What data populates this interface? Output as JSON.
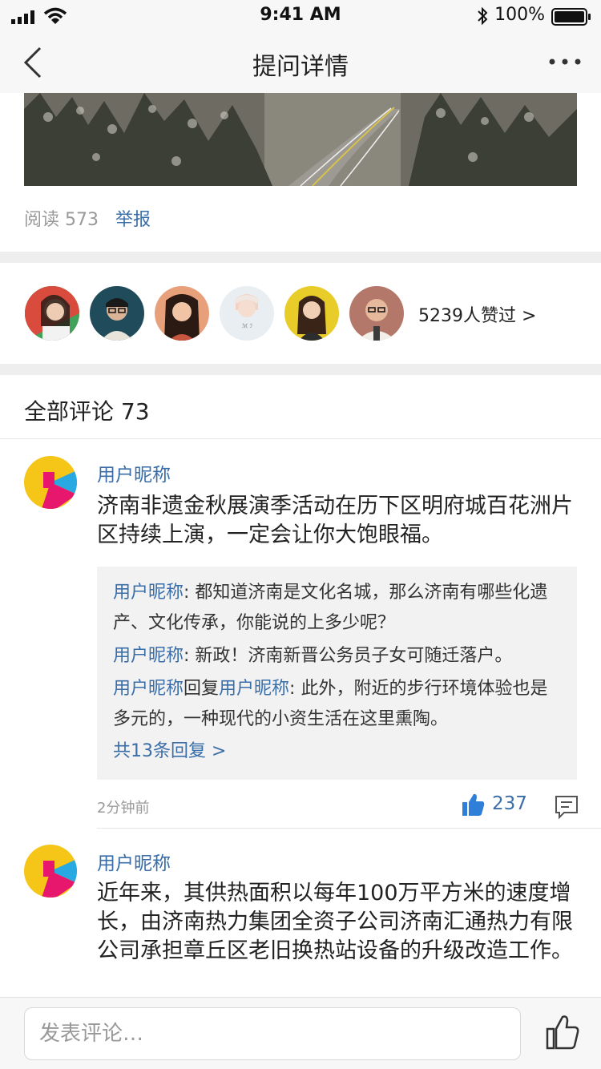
{
  "status_bar": {
    "time": "9:41 AM",
    "battery": "100%"
  },
  "nav": {
    "title": "提问详情"
  },
  "article": {
    "read_label": "阅读 573",
    "report_label": "举报"
  },
  "likers": {
    "avatars": [
      "avatar-1",
      "avatar-2",
      "avatar-3",
      "avatar-4",
      "avatar-5",
      "avatar-6"
    ],
    "count_label": "5239人赞过 >"
  },
  "comments_header": {
    "label": "全部评论 73"
  },
  "comments": [
    {
      "user": "用户昵称",
      "text": "济南非遗金秋展演季活动在历下区明府城百花洲片区持续上演，一定会让你大饱眼福。",
      "replies": [
        {
          "user": "用户昵称",
          "sep": ": ",
          "text": "都知道济南是文化名城，那么济南有哪些化遗产、文化传承，你能说的上多少呢？"
        },
        {
          "user": "用户昵称",
          "sep": ": ",
          "text": "新政！济南新晋公务员子女可随迁落户。"
        },
        {
          "user": "用户昵称",
          "mid": "回复",
          "to_user": "用户昵称",
          "sep": ": ",
          "text": "此外，附近的步行环境体验也是多元的，一种现代的小资生活在这里熏陶。"
        }
      ],
      "more_replies": "共13条回复 >",
      "time": "2分钟前",
      "likes": "237"
    },
    {
      "user": "用户昵称",
      "text": "近年来，其供热面积以每年100万平方米的速度增长，由济南热力集团全资子公司济南汇通热力有限公司承担章丘区老旧换热站设备的升级改造工作。"
    }
  ],
  "bottom_bar": {
    "input_placeholder": "发表评论…"
  },
  "colors": {
    "link": "#3a6ea8",
    "like_blue": "#2f7fd9",
    "background_band": "#eeeeee"
  }
}
